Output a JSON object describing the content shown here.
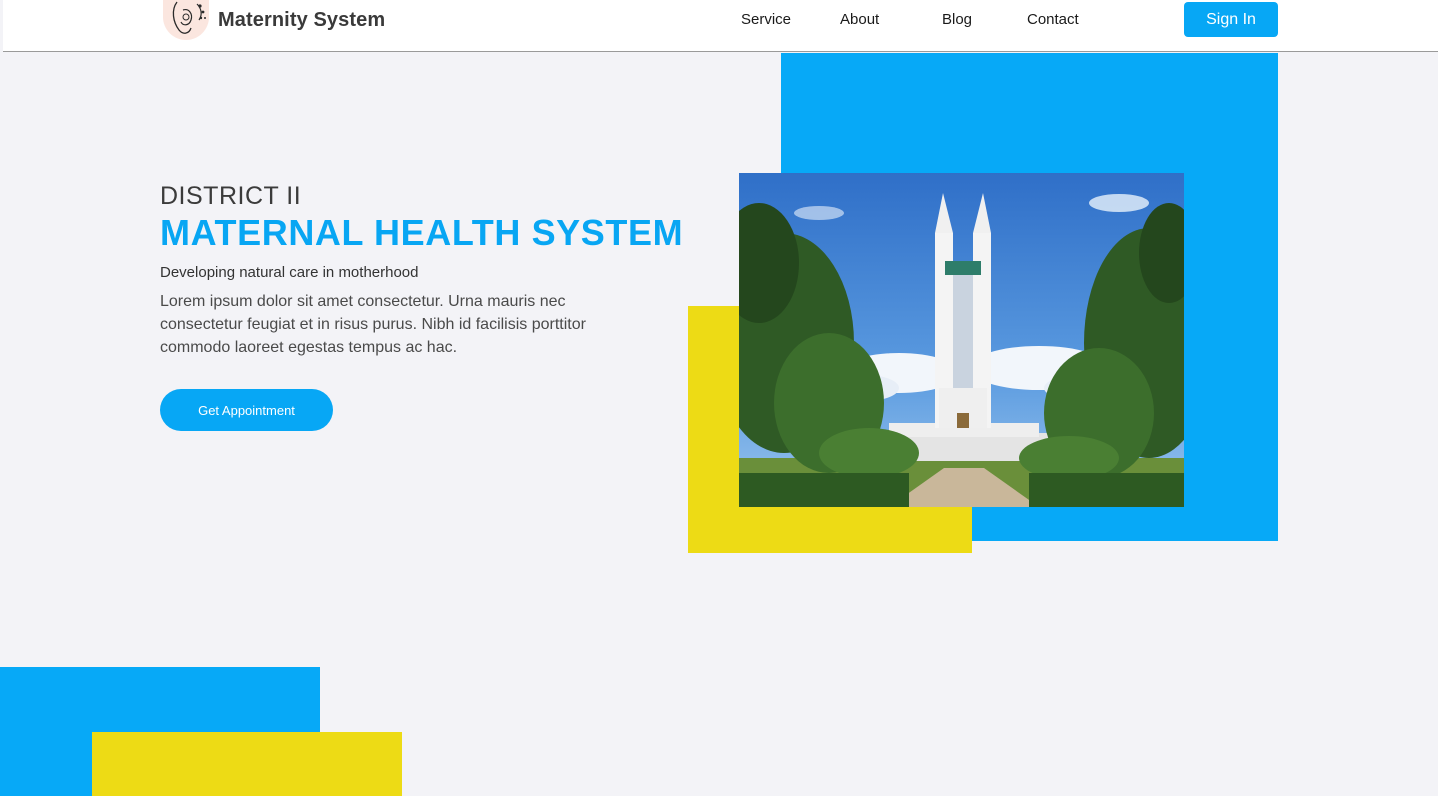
{
  "header": {
    "brand_name": "Maternity System",
    "logo_icon": "mother-and-baby-logo-icon",
    "nav": [
      {
        "label": "Service"
      },
      {
        "label": "About"
      },
      {
        "label": "Blog"
      },
      {
        "label": "Contact"
      }
    ],
    "signin_label": "Sign In"
  },
  "hero": {
    "subtitle": "DISTRICT II",
    "title": "MATERNAL HEALTH SYSTEM",
    "tagline": "Developing natural care in motherhood",
    "description": "Lorem ipsum dolor sit amet consectetur. Urna mauris nec consectetur feugiat et in risus purus. Nibh id facilisis porttitor commodo laoreet egestas tempus ac hac.",
    "cta_label": "Get Appointment",
    "image": "monument-photo"
  },
  "colors": {
    "accent_blue": "#07a9f7",
    "accent_yellow": "#eddb15",
    "background": "#f3f3f7",
    "text_dark": "#3a3a3a"
  }
}
